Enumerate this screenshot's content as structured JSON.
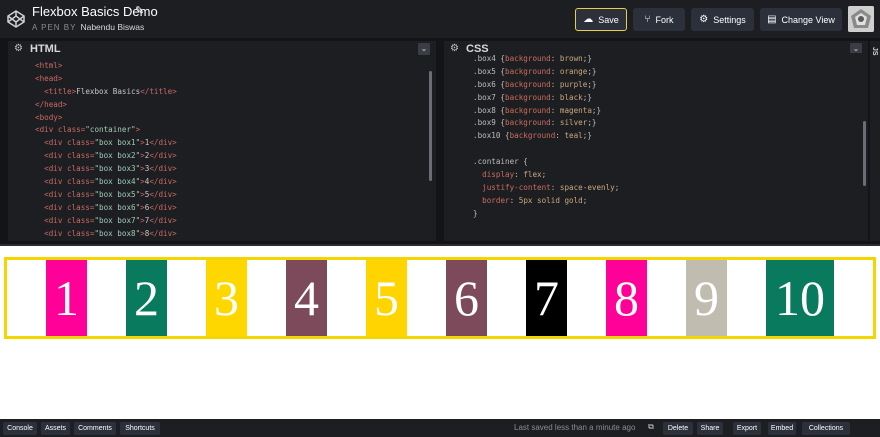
{
  "header": {
    "title": "Flexbox Basics Demo",
    "byline_prefix": "A PEN BY",
    "author": "Nabendu Biswas",
    "buttons": {
      "save": "Save",
      "fork": "Fork",
      "settings": "Settings",
      "change_view": "Change View"
    }
  },
  "editors": {
    "html": {
      "label": "HTML",
      "lines": [
        [
          [
            "tag",
            "<html>"
          ]
        ],
        [
          [
            "tag",
            "<head>"
          ]
        ],
        [
          [
            "txt",
            "  "
          ],
          [
            "tag",
            "<title>"
          ],
          [
            "txt",
            "Flexbox Basics"
          ],
          [
            "tag",
            "</title>"
          ]
        ],
        [
          [
            "tag",
            "</head>"
          ]
        ],
        [
          [
            "tag",
            "<body>"
          ]
        ],
        [
          [
            "tag",
            "<div "
          ],
          [
            "attr",
            "class="
          ],
          [
            "str",
            "\"container\""
          ],
          [
            "tag",
            ">"
          ]
        ],
        [
          [
            "txt",
            "  "
          ],
          [
            "tag",
            "<div "
          ],
          [
            "attr",
            "class="
          ],
          [
            "str",
            "\"box box1\""
          ],
          [
            "tag",
            ">"
          ],
          [
            "txt",
            "1"
          ],
          [
            "tag",
            "</div>"
          ]
        ],
        [
          [
            "txt",
            "  "
          ],
          [
            "tag",
            "<div "
          ],
          [
            "attr",
            "class="
          ],
          [
            "str",
            "\"box box2\""
          ],
          [
            "tag",
            ">"
          ],
          [
            "txt",
            "2"
          ],
          [
            "tag",
            "</div>"
          ]
        ],
        [
          [
            "txt",
            "  "
          ],
          [
            "tag",
            "<div "
          ],
          [
            "attr",
            "class="
          ],
          [
            "str",
            "\"box box3\""
          ],
          [
            "tag",
            ">"
          ],
          [
            "txt",
            "3"
          ],
          [
            "tag",
            "</div>"
          ]
        ],
        [
          [
            "txt",
            "  "
          ],
          [
            "tag",
            "<div "
          ],
          [
            "attr",
            "class="
          ],
          [
            "str",
            "\"box box4\""
          ],
          [
            "tag",
            ">"
          ],
          [
            "txt",
            "4"
          ],
          [
            "tag",
            "</div>"
          ]
        ],
        [
          [
            "txt",
            "  "
          ],
          [
            "tag",
            "<div "
          ],
          [
            "attr",
            "class="
          ],
          [
            "str",
            "\"box box5\""
          ],
          [
            "tag",
            ">"
          ],
          [
            "txt",
            "5"
          ],
          [
            "tag",
            "</div>"
          ]
        ],
        [
          [
            "txt",
            "  "
          ],
          [
            "tag",
            "<div "
          ],
          [
            "attr",
            "class="
          ],
          [
            "str",
            "\"box box6\""
          ],
          [
            "tag",
            ">"
          ],
          [
            "txt",
            "6"
          ],
          [
            "tag",
            "</div>"
          ]
        ],
        [
          [
            "txt",
            "  "
          ],
          [
            "tag",
            "<div "
          ],
          [
            "attr",
            "class="
          ],
          [
            "str",
            "\"box box7\""
          ],
          [
            "tag",
            ">"
          ],
          [
            "txt",
            "7"
          ],
          [
            "tag",
            "</div>"
          ]
        ],
        [
          [
            "txt",
            "  "
          ],
          [
            "tag",
            "<div "
          ],
          [
            "attr",
            "class="
          ],
          [
            "str",
            "\"box box8\""
          ],
          [
            "tag",
            ">"
          ],
          [
            "txt",
            "8"
          ],
          [
            "tag",
            "</div>"
          ]
        ]
      ]
    },
    "css": {
      "label": "CSS",
      "lines": [
        [
          [
            "sel",
            ".box4 {"
          ],
          [
            "prop",
            "background"
          ],
          [
            "sel",
            ": "
          ],
          [
            "val",
            "brown"
          ],
          [
            "sel",
            ";}"
          ]
        ],
        [
          [
            "sel",
            ".box5 {"
          ],
          [
            "prop",
            "background"
          ],
          [
            "sel",
            ": "
          ],
          [
            "val",
            "orange"
          ],
          [
            "sel",
            ";}"
          ]
        ],
        [
          [
            "sel",
            ".box6 {"
          ],
          [
            "prop",
            "background"
          ],
          [
            "sel",
            ": "
          ],
          [
            "val",
            "purple"
          ],
          [
            "sel",
            ";}"
          ]
        ],
        [
          [
            "sel",
            ".box7 {"
          ],
          [
            "prop",
            "background"
          ],
          [
            "sel",
            ": "
          ],
          [
            "val",
            "black"
          ],
          [
            "sel",
            ";}"
          ]
        ],
        [
          [
            "sel",
            ".box8 {"
          ],
          [
            "prop",
            "background"
          ],
          [
            "sel",
            ": "
          ],
          [
            "val",
            "magenta"
          ],
          [
            "sel",
            ";}"
          ]
        ],
        [
          [
            "sel",
            ".box9 {"
          ],
          [
            "prop",
            "background"
          ],
          [
            "sel",
            ": "
          ],
          [
            "val",
            "silver"
          ],
          [
            "sel",
            ";}"
          ]
        ],
        [
          [
            "sel",
            ".box10 {"
          ],
          [
            "prop",
            "background"
          ],
          [
            "sel",
            ": "
          ],
          [
            "val",
            "teal"
          ],
          [
            "sel",
            ";}"
          ]
        ],
        [
          [
            "txt",
            " "
          ]
        ],
        [
          [
            "sel",
            ".container {"
          ]
        ],
        [
          [
            "txt",
            "  "
          ],
          [
            "prop",
            "display"
          ],
          [
            "sel",
            ": "
          ],
          [
            "val",
            "flex"
          ],
          [
            "sel",
            ";"
          ]
        ],
        [
          [
            "txt",
            "  "
          ],
          [
            "prop",
            "justify-content"
          ],
          [
            "sel",
            ": "
          ],
          [
            "val",
            "space-evenly"
          ],
          [
            "sel",
            ";"
          ]
        ],
        [
          [
            "txt",
            "  "
          ],
          [
            "prop",
            "border"
          ],
          [
            "sel",
            ": "
          ],
          [
            "val",
            "5px solid gold"
          ],
          [
            "sel",
            ";"
          ]
        ],
        [
          [
            "sel",
            "}"
          ]
        ]
      ]
    },
    "side_label": "JS"
  },
  "result": {
    "boxes": [
      {
        "label": "1",
        "color": "#ff0099"
      },
      {
        "label": "2",
        "color": "#0a7a5e"
      },
      {
        "label": "3",
        "color": "#ffd700"
      },
      {
        "label": "4",
        "color": "#7c4a5a"
      },
      {
        "label": "5",
        "color": "#ffd400"
      },
      {
        "label": "6",
        "color": "#7c4a5a"
      },
      {
        "label": "7",
        "color": "#000000"
      },
      {
        "label": "8",
        "color": "#ff0099"
      },
      {
        "label": "9",
        "color": "#c0bdb0"
      },
      {
        "label": "10",
        "color": "#0a7a5e"
      }
    ],
    "container_border_color": "#f4d500"
  },
  "footer": {
    "buttons_left": [
      "Console",
      "Assets",
      "Comments",
      "Shortcuts"
    ],
    "saved_status": "Last saved less than a minute ago",
    "buttons_right": [
      "Delete",
      "Share",
      "Export",
      "Embed",
      "Collections"
    ]
  },
  "colors": {
    "save_border": "#e8cf45",
    "header_bg": "#1d1e22"
  }
}
